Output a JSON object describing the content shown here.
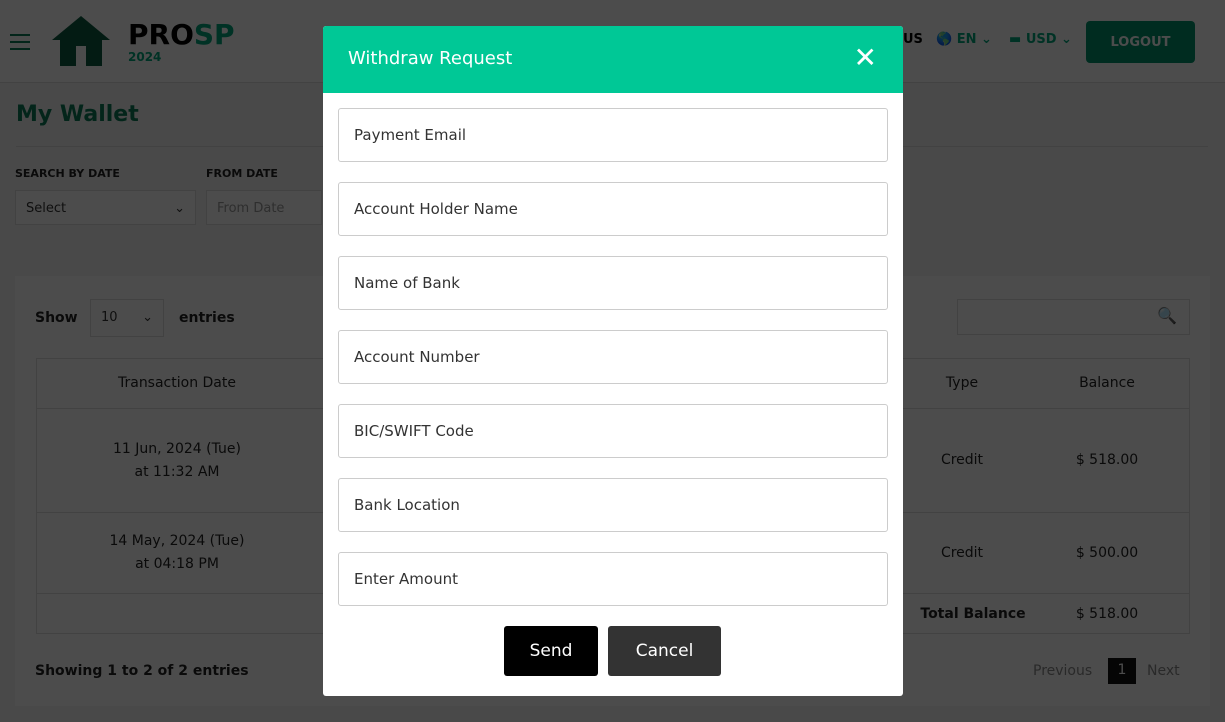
{
  "header": {
    "logo_a": "PRO",
    "logo_b": "SP",
    "logo_year": "2024",
    "nav_partial": "US",
    "language": "EN",
    "currency": "USD",
    "logout": "LOGOUT"
  },
  "page": {
    "title": "My Wallet",
    "search_by_date_label": "SEARCH BY DATE",
    "search_by_date_value": "Select",
    "from_date_label": "FROM DATE",
    "from_date_placeholder": "From Date"
  },
  "table": {
    "show": "Show",
    "entries_value": "10",
    "entries": "entries",
    "headers": {
      "date": "Transaction Date",
      "type": "Type",
      "balance": "Balance"
    },
    "rows": [
      {
        "date": "11 Jun, 2024 (Tue)",
        "time": "at 11:32 AM",
        "type": "Credit",
        "balance": "$ 518.00"
      },
      {
        "date": "14 May, 2024 (Tue)",
        "time": "at 04:18 PM",
        "type": "Credit",
        "balance": "$ 500.00"
      }
    ],
    "total_label": "Total Balance",
    "total_value": "$ 518.00",
    "info": "Showing 1 to 2 of 2 entries",
    "previous": "Previous",
    "page": "1",
    "next": "Next"
  },
  "modal": {
    "title": "Withdraw Request",
    "fields": [
      "Payment Email",
      "Account Holder Name",
      "Name of Bank",
      "Account Number",
      "BIC/SWIFT Code",
      "Bank Location",
      "Enter Amount"
    ],
    "send": "Send",
    "cancel": "Cancel"
  }
}
